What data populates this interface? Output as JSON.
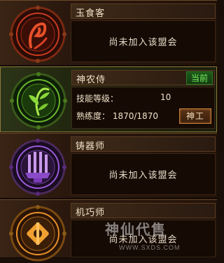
{
  "guilds": [
    {
      "name": "玉食客",
      "status_text": "尚未加入该盟会",
      "emblem_icon": "dragon-emblem-icon",
      "emblem_color": "#c83a1e"
    },
    {
      "name": "神农侍",
      "current_badge": "当前",
      "skill_level_label": "技能等级：",
      "skill_level_value": "10",
      "proficiency_label": "熟练度：",
      "proficiency_value": "1870/1870",
      "action_button": "神工",
      "emblem_icon": "herb-emblem-icon",
      "emblem_color": "#6ab82a"
    },
    {
      "name": "铸器师",
      "status_text": "尚未加入该盟会",
      "emblem_icon": "forge-emblem-icon",
      "emblem_color": "#9a5ad8"
    },
    {
      "name": "机巧师",
      "status_text": "尚未加入该盟会",
      "emblem_icon": "gear-emblem-icon",
      "emblem_color": "#e8902a"
    }
  ],
  "watermark": {
    "text": "神仙代售",
    "url": "WWW.SXDS.COM"
  }
}
